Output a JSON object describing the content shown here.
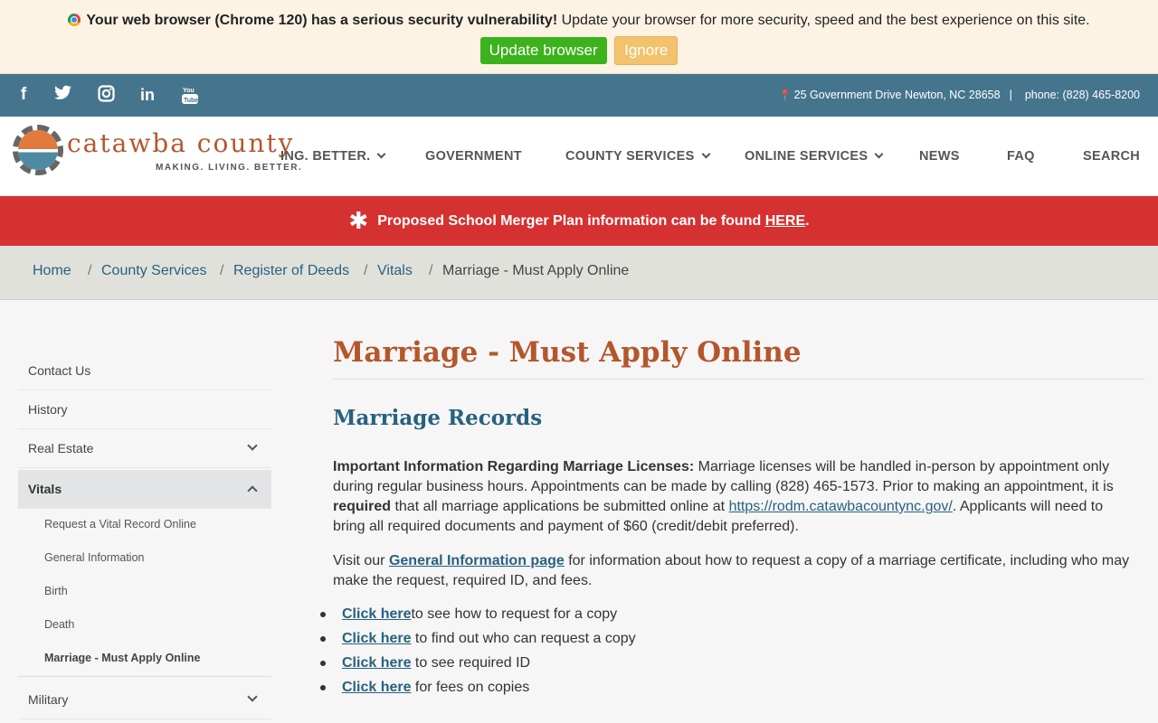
{
  "browser_warning": {
    "bold_text": "Your web browser (Chrome 120) has a serious security vulnerability!",
    "text": " Update your browser for more security, speed and the best experience on this site.",
    "update_label": "Update browser",
    "ignore_label": "Ignore"
  },
  "social_bar": {
    "icons": [
      "facebook-icon",
      "twitter-icon",
      "instagram-icon",
      "linkedin-icon",
      "youtube-icon"
    ],
    "address": "25 Government Drive Newton, NC 28658",
    "separator": "|",
    "phone": "phone: (828) 465-8200"
  },
  "header": {
    "logo_name": "catawba county",
    "logo_tagline": "MAKING. LIVING. BETTER.",
    "nav": [
      {
        "label": "ING. BETTER.",
        "has_dropdown": true
      },
      {
        "label": "GOVERNMENT",
        "has_dropdown": false
      },
      {
        "label": "COUNTY SERVICES",
        "has_dropdown": true
      },
      {
        "label": "ONLINE SERVICES",
        "has_dropdown": true
      },
      {
        "label": "NEWS",
        "has_dropdown": false
      },
      {
        "label": "FAQ",
        "has_dropdown": false
      },
      {
        "label": "SEARCH",
        "has_dropdown": false
      }
    ]
  },
  "alert": {
    "icon": "asterisk-icon",
    "text": "Proposed School Merger Plan information can be found ",
    "link": "HERE",
    "end": "."
  },
  "breadcrumb": {
    "items": [
      "Home",
      "County Services",
      "Register of Deeds",
      "Vitals",
      "Marriage - Must Apply Online"
    ],
    "separator": "/"
  },
  "sidebar": {
    "items": [
      {
        "label": "Contact Us"
      },
      {
        "label": "History"
      },
      {
        "label": "Real Estate",
        "expandable": true
      },
      {
        "label": "Vitals",
        "expanded": true
      },
      {
        "label": "Military",
        "expandable": true
      }
    ],
    "sub_items": [
      "Request a Vital Record Online",
      "General Information",
      "Birth",
      "Death",
      "Marriage - Must Apply Online"
    ]
  },
  "main": {
    "title": "Marriage - Must Apply Online",
    "section_title": "Marriage Records",
    "p1_bold": "Important Information Regarding Marriage Licenses:",
    "p1_a": " Marriage licenses will be handled in-person by appointment only during regular business hours. Appointments can be made by calling (828) 465-1573. Prior to making an appointment, it is ",
    "p1_required": "required",
    "p1_b": " that all marriage applications be submitted online at ",
    "p1_link": "https://rodm.catawbacountync.gov/",
    "p1_c": ". Applicants will need to bring all required documents and payment of $60 (credit/debit preferred).",
    "p2_a": "Visit our ",
    "p2_link": "General Information page",
    "p2_b": " for information about how to request a copy of a marriage certificate, including who may make the request, required ID, and fees.",
    "links": [
      {
        "link": "Click here",
        "text": "to see how to request for a copy"
      },
      {
        "link": "Click here",
        "text": " to find out who can request a copy"
      },
      {
        "link": "Click here",
        "text": " to see required ID"
      },
      {
        "link": "Click here",
        "text": " for fees on copies"
      }
    ]
  }
}
